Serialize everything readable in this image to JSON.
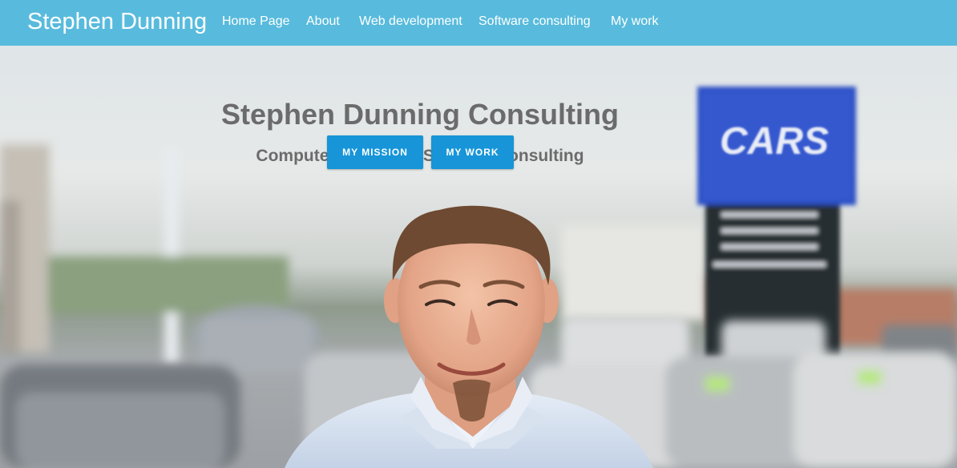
{
  "navbar": {
    "brand": "Stephen Dunning",
    "links": [
      "Home Page",
      "About",
      "Web development",
      "Software consulting",
      "My work"
    ]
  },
  "hero": {
    "title": "Stephen Dunning Consulting",
    "subtitle": "Computer, Web, and Software consulting",
    "buttons": [
      "MY MISSION",
      "MY WORK"
    ],
    "sign_text": "CARS"
  },
  "colors": {
    "navbar": "#58bbdd",
    "button": "#1795d8",
    "hero_text": "#6b6b6b"
  }
}
